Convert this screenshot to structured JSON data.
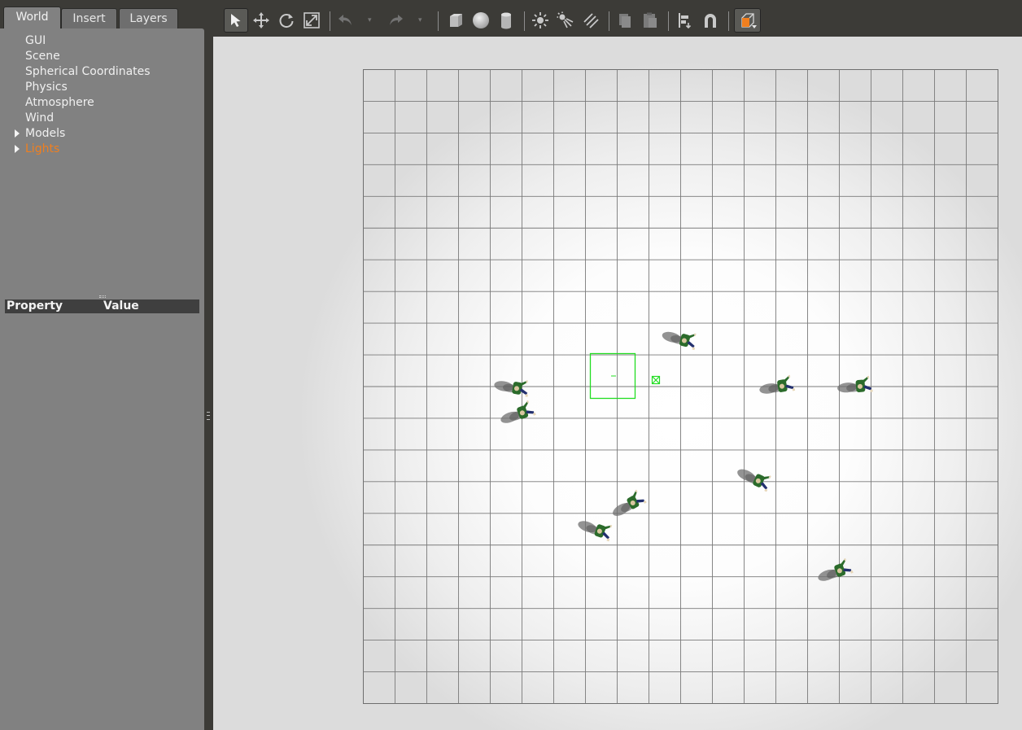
{
  "tabs": [
    {
      "label": "World",
      "active": true
    },
    {
      "label": "Insert",
      "active": false
    },
    {
      "label": "Layers",
      "active": false
    }
  ],
  "tree": [
    {
      "label": "GUI",
      "expandable": false,
      "highlighted": false
    },
    {
      "label": "Scene",
      "expandable": false,
      "highlighted": false
    },
    {
      "label": "Spherical Coordinates",
      "expandable": false,
      "highlighted": false
    },
    {
      "label": "Physics",
      "expandable": false,
      "highlighted": false
    },
    {
      "label": "Atmosphere",
      "expandable": false,
      "highlighted": false
    },
    {
      "label": "Wind",
      "expandable": false,
      "highlighted": false
    },
    {
      "label": "Models",
      "expandable": true,
      "highlighted": false
    },
    {
      "label": "Lights",
      "expandable": true,
      "highlighted": true
    }
  ],
  "properties": {
    "col_property": "Property",
    "col_value": "Value"
  },
  "toolbar": {
    "tools": [
      {
        "icon": "select-arrow-icon",
        "selected": true
      },
      {
        "icon": "translate-icon"
      },
      {
        "icon": "rotate-icon"
      },
      {
        "icon": "scale-icon"
      },
      {
        "icon": "undo-icon",
        "disabled": true
      },
      {
        "icon": "undo-history-icon",
        "disabled": true
      },
      {
        "icon": "redo-icon",
        "disabled": true
      },
      {
        "icon": "redo-history-icon",
        "disabled": true
      },
      {
        "icon": "box-shape-icon"
      },
      {
        "icon": "sphere-shape-icon"
      },
      {
        "icon": "cylinder-shape-icon"
      },
      {
        "icon": "point-light-icon"
      },
      {
        "icon": "spot-light-icon"
      },
      {
        "icon": "directional-light-icon"
      },
      {
        "icon": "copy-icon",
        "disabled": true
      },
      {
        "icon": "paste-icon",
        "disabled": true
      },
      {
        "icon": "align-icon"
      },
      {
        "icon": "snap-magnet-icon"
      },
      {
        "icon": "view-angle-icon"
      }
    ]
  },
  "colors": {
    "panel_bg": "#818181",
    "window_bg": "#3c3b37",
    "highlight": "#f07f1f",
    "grid_line": "#6e6e6e",
    "selection_green": "#22dd22",
    "actor_shirt": "#2b6b2b",
    "actor_pants": "#23306e"
  },
  "scene": {
    "grid_cells": 20,
    "actors": 10,
    "selection_box": true,
    "origin_marker": true
  }
}
